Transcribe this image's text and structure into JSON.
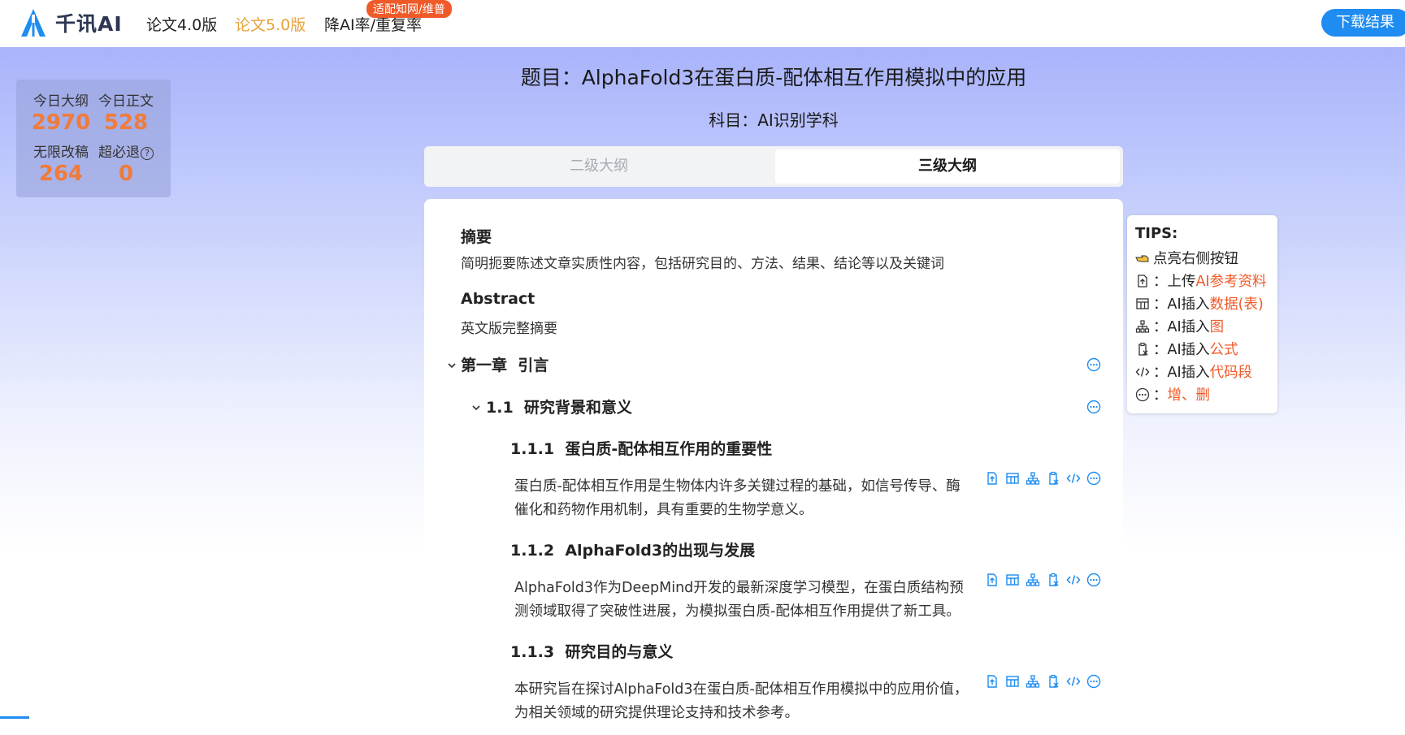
{
  "header": {
    "logo_text": "千讯AI",
    "nav": [
      {
        "label": "论文4.0版",
        "active": false
      },
      {
        "label": "论文5.0版",
        "active": true
      },
      {
        "label": "降AI率/重复率",
        "active": false
      }
    ],
    "badge": "适配知网/维普",
    "download_label": "下载结果"
  },
  "stats": {
    "today_outline": {
      "label": "今日大纲",
      "value": "2970"
    },
    "today_body": {
      "label": "今日正文",
      "value": "528"
    },
    "unlimited_revise": {
      "label": "无限改稿",
      "value": "264"
    },
    "refund": {
      "label": "超必退",
      "value": "0"
    }
  },
  "title": "题目：AlphaFold3在蛋白质-配体相互作用模拟中的应用",
  "subject": "科目：AI识别学科",
  "tabs": [
    {
      "label": "二级大纲",
      "active": false
    },
    {
      "label": "三级大纲",
      "active": true
    }
  ],
  "outline": {
    "abstract_cn": {
      "heading": "摘要",
      "desc": "简明扼要陈述文章实质性内容，包括研究目的、方法、结果、结论等以及关键词"
    },
    "abstract_en": {
      "heading": "Abstract",
      "desc": "英文版完整摘要"
    },
    "chapter1": {
      "number": "第一章",
      "title": "引言"
    },
    "section1_1": {
      "number": "1.1",
      "title": "研究背景和意义"
    },
    "subsections": [
      {
        "number": "1.1.1",
        "title": "蛋白质-配体相互作用的重要性",
        "text": "蛋白质-配体相互作用是生物体内许多关键过程的基础，如信号传导、酶催化和药物作用机制，具有重要的生物学意义。"
      },
      {
        "number": "1.1.2",
        "title": "AlphaFold3的出现与发展",
        "text": "AlphaFold3作为DeepMind开发的最新深度学习模型，在蛋白质结构预测领域取得了突破性进展，为模拟蛋白质-配体相互作用提供了新工具。"
      },
      {
        "number": "1.1.3",
        "title": "研究目的与意义",
        "text": "本研究旨在探讨AlphaFold3在蛋白质-配体相互作用模拟中的应用价值，为相关领域的研究提供理论支持和技术参考。"
      }
    ]
  },
  "tips": {
    "title": "TIPS:",
    "rows": [
      {
        "icon": "pointing-hand-icon",
        "prefix": "点亮右侧按钮",
        "highlight": ""
      },
      {
        "icon": "upload-file-icon",
        "prefix": "：上传",
        "highlight": "AI参考资料"
      },
      {
        "icon": "table-icon",
        "prefix": "：AI插入",
        "highlight": "数据(表)"
      },
      {
        "icon": "hierarchy-icon",
        "prefix": "：AI插入",
        "highlight": "图"
      },
      {
        "icon": "formula-clipboard-icon",
        "prefix": "：AI插入",
        "highlight": "公式"
      },
      {
        "icon": "code-icon",
        "prefix": "：AI插入",
        "highlight": "代码段"
      },
      {
        "icon": "more-circle-icon",
        "prefix": "：",
        "highlight": "增、删"
      }
    ]
  },
  "colors": {
    "accent": "#1e8cf0",
    "orange": "#f07b3a",
    "highlight": "#f05a28",
    "nav_active": "#e6a23c"
  }
}
